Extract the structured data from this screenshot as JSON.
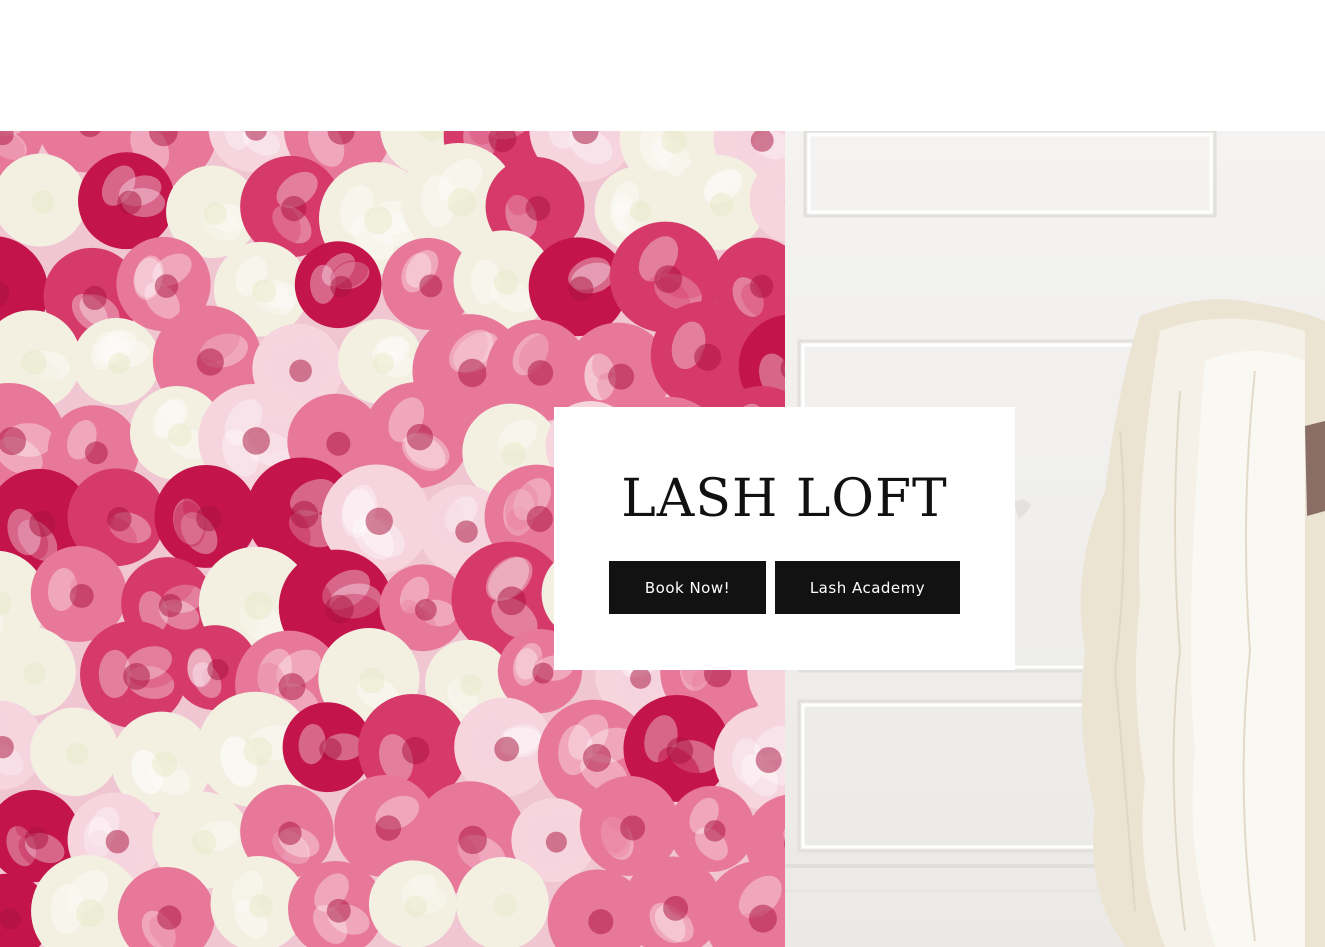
{
  "hero": {
    "left_image": "pink-and-white-peony-flower-wall",
    "right_image": "white-paneled-wall-with-cream-blanket",
    "colors": {
      "flower_deep_pink": "#c4144c",
      "flower_pink": "#e8789a",
      "flower_cream": "#f3f0e2",
      "wall_white": "#f3f2f0",
      "blanket_cream": "#ede6d6"
    }
  },
  "card": {
    "title": "LASH LOFT",
    "buttons": {
      "book_label": "Book Now!",
      "academy_label": "Lash Academy"
    },
    "colors": {
      "button_bg": "#121212",
      "button_text": "#ffffff",
      "title": "#111111"
    }
  }
}
